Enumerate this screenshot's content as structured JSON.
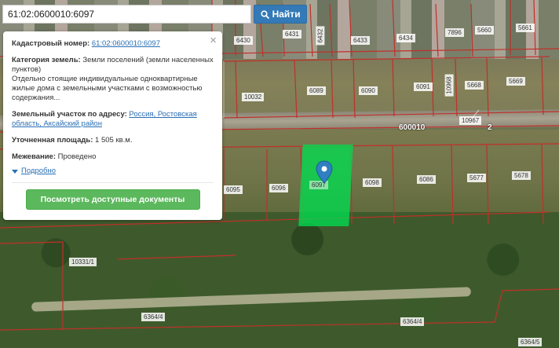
{
  "search": {
    "value": "61:02:0600010:6097",
    "button_label": "Найти"
  },
  "panel": {
    "cadastral_label": "Кадастровый номер:",
    "cadastral_value": "61:02:0600010:6097",
    "category_label": "Категория земель:",
    "category_value": "Земли поселений (земли населенных пунктов)",
    "category_desc": "Отдельно стоящие индивидуальные одноквартирные жилые дома с земельными участками с возможностью содержания...",
    "address_label": "Земельный участок по адресу:",
    "address_value": "Россия, Ростовская область, Аксайский район",
    "area_label": "Уточненная площадь:",
    "area_value": "1 505 кв.м.",
    "survey_label": "Межевание:",
    "survey_value": "Проведено",
    "more_label": "Подробно",
    "docs_button": "Посмотреть доступные документы",
    "close_symbol": "×"
  },
  "map": {
    "labels": [
      "6430",
      "6431",
      "6432",
      "6433",
      "6434",
      "7896",
      "5660",
      "5661",
      "6089",
      "6090",
      "6091",
      "10968",
      "5668",
      "5669",
      "10032",
      "10967",
      "600010",
      "2",
      "6095",
      "6096",
      "6097",
      "6098",
      "6086",
      "5677",
      "5678",
      "10331/1",
      "6364/4",
      "6364/4",
      "6364/5"
    ],
    "highlight_color": "#00dc50"
  },
  "colors": {
    "accent": "#337ab7",
    "link": "#2a6fb5",
    "button_green": "#5cb85c",
    "parcel_line": "#c0302a"
  }
}
